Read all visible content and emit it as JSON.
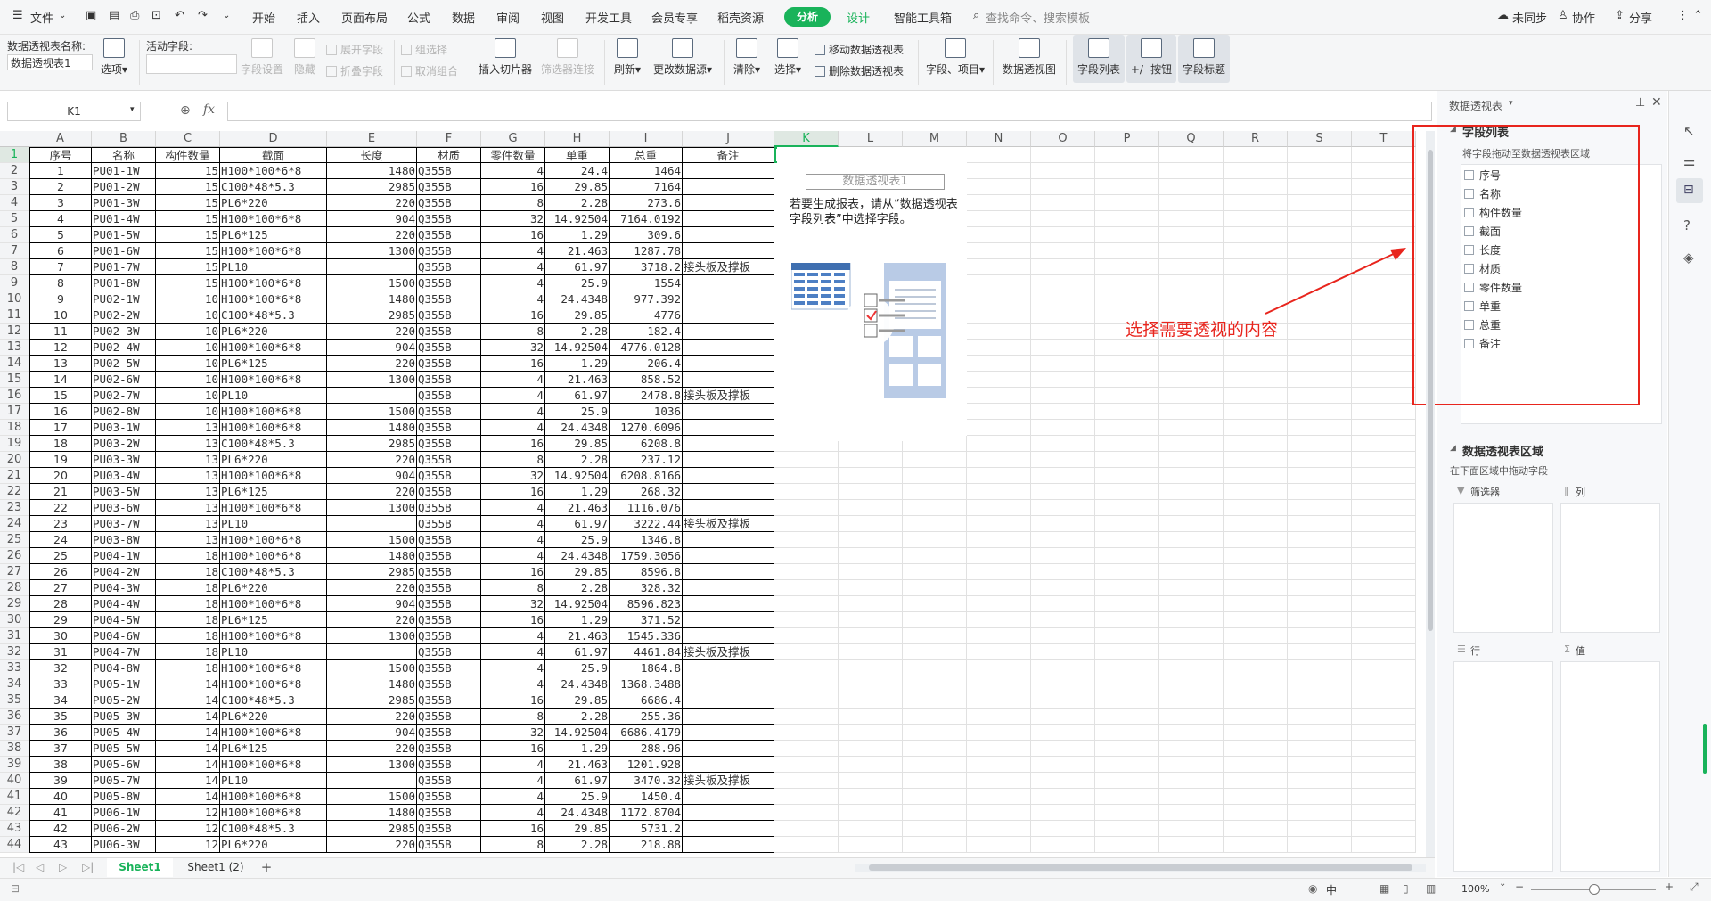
{
  "menu": {
    "file": "文件",
    "items": [
      "开始",
      "插入",
      "页面布局",
      "公式",
      "数据",
      "审阅",
      "视图",
      "开发工具",
      "会员专享",
      "稻壳资源"
    ],
    "active": "分析",
    "design": "设计",
    "smart_tools": "智能工具箱",
    "search_placeholder": "查找命令、搜索模板",
    "unsynced": "未同步",
    "collab": "协作",
    "share": "分享"
  },
  "ribbon": {
    "pivot_name_label": "数据透视表名称:",
    "pivot_name_value": "数据透视表1",
    "options": "选项",
    "active_field_label": "活动字段:",
    "field_settings": "字段设置",
    "hide": "隐藏",
    "expand_field": "展开字段",
    "collapse_field": "折叠字段",
    "group_selection": "组选择",
    "ungroup": "取消组合",
    "insert_slicer": "插入切片器",
    "filter_connection": "筛选器连接",
    "refresh": "刷新",
    "change_source": "更改数据源",
    "clear": "清除",
    "select": "选择",
    "move_pivot": "移动数据透视表",
    "delete_pivot": "删除数据透视表",
    "fields_items": "字段、项目",
    "pivot_chart": "数据透视图",
    "field_list": "字段列表",
    "plus_minus": "+/- 按钮",
    "field_headers": "字段标题"
  },
  "formula_bar": {
    "namebox": "K1",
    "fx": "fx"
  },
  "colors": {
    "accent": "#19b35a",
    "annotation": "#e8251d",
    "cell_border": "#000000"
  },
  "sheet": {
    "columns": [
      "A",
      "B",
      "C",
      "D",
      "E",
      "F",
      "G",
      "H",
      "I",
      "J",
      "K",
      "L",
      "M",
      "N",
      "O",
      "P",
      "Q",
      "R",
      "S",
      "T"
    ],
    "headers": [
      "序号",
      "名称",
      "构件数量",
      "截面",
      "长度",
      "材质",
      "零件数量",
      "单重",
      "总重",
      "备注"
    ],
    "rows": [
      [
        "1",
        "PU01-1W",
        "15",
        "H100*100*6*8",
        "1480",
        "Q355B",
        "4",
        "24.4",
        "1464",
        ""
      ],
      [
        "2",
        "PU01-2W",
        "15",
        "C100*48*5.3",
        "2985",
        "Q355B",
        "16",
        "29.85",
        "7164",
        ""
      ],
      [
        "3",
        "PU01-3W",
        "15",
        "PL6*220",
        "220",
        "Q355B",
        "8",
        "2.28",
        "273.6",
        ""
      ],
      [
        "4",
        "PU01-4W",
        "15",
        "H100*100*6*8",
        "904",
        "Q355B",
        "32",
        "14.92504",
        "7164.0192",
        ""
      ],
      [
        "5",
        "PU01-5W",
        "15",
        "PL6*125",
        "220",
        "Q355B",
        "16",
        "1.29",
        "309.6",
        ""
      ],
      [
        "6",
        "PU01-6W",
        "15",
        "H100*100*6*8",
        "1300",
        "Q355B",
        "4",
        "21.463",
        "1287.78",
        ""
      ],
      [
        "7",
        "PU01-7W",
        "15",
        "PL10",
        "",
        "Q355B",
        "4",
        "61.97",
        "3718.2",
        "接头板及撑板"
      ],
      [
        "8",
        "PU01-8W",
        "15",
        "H100*100*6*8",
        "1500",
        "Q355B",
        "4",
        "25.9",
        "1554",
        ""
      ],
      [
        "9",
        "PU02-1W",
        "10",
        "H100*100*6*8",
        "1480",
        "Q355B",
        "4",
        "24.4348",
        "977.392",
        ""
      ],
      [
        "10",
        "PU02-2W",
        "10",
        "C100*48*5.3",
        "2985",
        "Q355B",
        "16",
        "29.85",
        "4776",
        ""
      ],
      [
        "11",
        "PU02-3W",
        "10",
        "PL6*220",
        "220",
        "Q355B",
        "8",
        "2.28",
        "182.4",
        ""
      ],
      [
        "12",
        "PU02-4W",
        "10",
        "H100*100*6*8",
        "904",
        "Q355B",
        "32",
        "14.92504",
        "4776.0128",
        ""
      ],
      [
        "13",
        "PU02-5W",
        "10",
        "PL6*125",
        "220",
        "Q355B",
        "16",
        "1.29",
        "206.4",
        ""
      ],
      [
        "14",
        "PU02-6W",
        "10",
        "H100*100*6*8",
        "1300",
        "Q355B",
        "4",
        "21.463",
        "858.52",
        ""
      ],
      [
        "15",
        "PU02-7W",
        "10",
        "PL10",
        "",
        "Q355B",
        "4",
        "61.97",
        "2478.8",
        "接头板及撑板"
      ],
      [
        "16",
        "PU02-8W",
        "10",
        "H100*100*6*8",
        "1500",
        "Q355B",
        "4",
        "25.9",
        "1036",
        ""
      ],
      [
        "17",
        "PU03-1W",
        "13",
        "H100*100*6*8",
        "1480",
        "Q355B",
        "4",
        "24.4348",
        "1270.6096",
        ""
      ],
      [
        "18",
        "PU03-2W",
        "13",
        "C100*48*5.3",
        "2985",
        "Q355B",
        "16",
        "29.85",
        "6208.8",
        ""
      ],
      [
        "19",
        "PU03-3W",
        "13",
        "PL6*220",
        "220",
        "Q355B",
        "8",
        "2.28",
        "237.12",
        ""
      ],
      [
        "20",
        "PU03-4W",
        "13",
        "H100*100*6*8",
        "904",
        "Q355B",
        "32",
        "14.92504",
        "6208.8166",
        ""
      ],
      [
        "21",
        "PU03-5W",
        "13",
        "PL6*125",
        "220",
        "Q355B",
        "16",
        "1.29",
        "268.32",
        ""
      ],
      [
        "22",
        "PU03-6W",
        "13",
        "H100*100*6*8",
        "1300",
        "Q355B",
        "4",
        "21.463",
        "1116.076",
        ""
      ],
      [
        "23",
        "PU03-7W",
        "13",
        "PL10",
        "",
        "Q355B",
        "4",
        "61.97",
        "3222.44",
        "接头板及撑板"
      ],
      [
        "24",
        "PU03-8W",
        "13",
        "H100*100*6*8",
        "1500",
        "Q355B",
        "4",
        "25.9",
        "1346.8",
        ""
      ],
      [
        "25",
        "PU04-1W",
        "18",
        "H100*100*6*8",
        "1480",
        "Q355B",
        "4",
        "24.4348",
        "1759.3056",
        ""
      ],
      [
        "26",
        "PU04-2W",
        "18",
        "C100*48*5.3",
        "2985",
        "Q355B",
        "16",
        "29.85",
        "8596.8",
        ""
      ],
      [
        "27",
        "PU04-3W",
        "18",
        "PL6*220",
        "220",
        "Q355B",
        "8",
        "2.28",
        "328.32",
        ""
      ],
      [
        "28",
        "PU04-4W",
        "18",
        "H100*100*6*8",
        "904",
        "Q355B",
        "32",
        "14.92504",
        "8596.823",
        ""
      ],
      [
        "29",
        "PU04-5W",
        "18",
        "PL6*125",
        "220",
        "Q355B",
        "16",
        "1.29",
        "371.52",
        ""
      ],
      [
        "30",
        "PU04-6W",
        "18",
        "H100*100*6*8",
        "1300",
        "Q355B",
        "4",
        "21.463",
        "1545.336",
        ""
      ],
      [
        "31",
        "PU04-7W",
        "18",
        "PL10",
        "",
        "Q355B",
        "4",
        "61.97",
        "4461.84",
        "接头板及撑板"
      ],
      [
        "32",
        "PU04-8W",
        "18",
        "H100*100*6*8",
        "1500",
        "Q355B",
        "4",
        "25.9",
        "1864.8",
        ""
      ],
      [
        "33",
        "PU05-1W",
        "14",
        "H100*100*6*8",
        "1480",
        "Q355B",
        "4",
        "24.4348",
        "1368.3488",
        ""
      ],
      [
        "34",
        "PU05-2W",
        "14",
        "C100*48*5.3",
        "2985",
        "Q355B",
        "16",
        "29.85",
        "6686.4",
        ""
      ],
      [
        "35",
        "PU05-3W",
        "14",
        "PL6*220",
        "220",
        "Q355B",
        "8",
        "2.28",
        "255.36",
        ""
      ],
      [
        "36",
        "PU05-4W",
        "14",
        "H100*100*6*8",
        "904",
        "Q355B",
        "32",
        "14.92504",
        "6686.4179",
        ""
      ],
      [
        "37",
        "PU05-5W",
        "14",
        "PL6*125",
        "220",
        "Q355B",
        "16",
        "1.29",
        "288.96",
        ""
      ],
      [
        "38",
        "PU05-6W",
        "14",
        "H100*100*6*8",
        "1300",
        "Q355B",
        "4",
        "21.463",
        "1201.928",
        ""
      ],
      [
        "39",
        "PU05-7W",
        "14",
        "PL10",
        "",
        "Q355B",
        "4",
        "61.97",
        "3470.32",
        "接头板及撑板"
      ],
      [
        "40",
        "PU05-8W",
        "14",
        "H100*100*6*8",
        "1500",
        "Q355B",
        "4",
        "25.9",
        "1450.4",
        ""
      ],
      [
        "41",
        "PU06-1W",
        "12",
        "H100*100*6*8",
        "1480",
        "Q355B",
        "4",
        "24.4348",
        "1172.8704",
        ""
      ],
      [
        "42",
        "PU06-2W",
        "12",
        "C100*48*5.3",
        "2985",
        "Q355B",
        "16",
        "29.85",
        "5731.2",
        ""
      ],
      [
        "43",
        "PU06-3W",
        "12",
        "PL6*220",
        "220",
        "Q355B",
        "8",
        "2.28",
        "218.88",
        ""
      ]
    ]
  },
  "pivot_placeholder": {
    "title": "数据透视表1",
    "hint": "若要生成报表，请从“数据透视表字段列表”中选择字段。"
  },
  "annotation": "选择需要透视的内容",
  "panel": {
    "title": "数据透视表",
    "field_list_title": "字段列表",
    "drag_hint": "将字段拖动至数据透视表区域",
    "fields": [
      "序号",
      "名称",
      "构件数量",
      "截面",
      "长度",
      "材质",
      "零件数量",
      "单重",
      "总重",
      "备注"
    ],
    "areas_title": "数据透视表区域",
    "areas_hint": "在下面区域中拖动字段",
    "filter": "筛选器",
    "column": "列",
    "row": "行",
    "value": "值"
  },
  "tabs": {
    "sheet1": "Sheet1",
    "sheet1_2": "Sheet1 (2)",
    "add": "+"
  },
  "status": {
    "lang": "中",
    "zoom": "100%"
  }
}
